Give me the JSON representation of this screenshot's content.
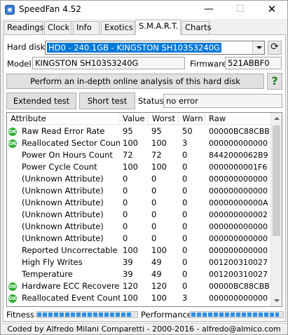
{
  "window": {
    "title": "SpeedFan 4.52",
    "minimize": "—",
    "maximize": "☐",
    "close": "✕"
  },
  "tabs": [
    {
      "label": "Readings"
    },
    {
      "label": "Clock"
    },
    {
      "label": "Info"
    },
    {
      "label": "Exotics"
    },
    {
      "label": "S.M.A.R.T."
    },
    {
      "label": "Charts"
    }
  ],
  "active_tab": "S.M.A.R.T.",
  "disk": {
    "label": "Hard disk",
    "selected": "HD0 - 240.1GB - KINGSTON SH103S3240G",
    "model_label": "Model",
    "model": "KINGSTON SH103S3240G",
    "firmware_label": "Firmware",
    "firmware": "521ABBF0"
  },
  "buttons": {
    "analysis": "Perform an in-depth online analysis of this hard disk",
    "help": "?",
    "extended": "Extended test",
    "short": "Short test"
  },
  "status": {
    "label": "Status",
    "value": "no error"
  },
  "table": {
    "headers": {
      "attribute": "Attribute",
      "value": "Value",
      "worst": "Worst",
      "warn": "Warn",
      "raw": "Raw"
    },
    "rows": [
      {
        "ok": true,
        "attribute": "Raw Read Error Rate",
        "value": "95",
        "worst": "95",
        "warn": "50",
        "raw": "00000BC88CBB"
      },
      {
        "ok": true,
        "attribute": "Reallocated Sector Count",
        "value": "100",
        "worst": "100",
        "warn": "3",
        "raw": "000000000000"
      },
      {
        "ok": false,
        "attribute": "Power On Hours Count",
        "value": "72",
        "worst": "72",
        "warn": "0",
        "raw": "8442000062B9"
      },
      {
        "ok": false,
        "attribute": "Power Cycle Count",
        "value": "100",
        "worst": "100",
        "warn": "0",
        "raw": "0000000001F6"
      },
      {
        "ok": false,
        "attribute": "(Unknown Attribute)",
        "value": "0",
        "worst": "0",
        "warn": "0",
        "raw": "000000000000"
      },
      {
        "ok": false,
        "attribute": "(Unknown Attribute)",
        "value": "0",
        "worst": "0",
        "warn": "0",
        "raw": "000000000000"
      },
      {
        "ok": false,
        "attribute": "(Unknown Attribute)",
        "value": "0",
        "worst": "0",
        "warn": "0",
        "raw": "00000000000A"
      },
      {
        "ok": false,
        "attribute": "(Unknown Attribute)",
        "value": "0",
        "worst": "0",
        "warn": "0",
        "raw": "000000000002"
      },
      {
        "ok": false,
        "attribute": "(Unknown Attribute)",
        "value": "0",
        "worst": "0",
        "warn": "0",
        "raw": "000000000000"
      },
      {
        "ok": false,
        "attribute": "(Unknown Attribute)",
        "value": "0",
        "worst": "0",
        "warn": "0",
        "raw": "000000000000"
      },
      {
        "ok": false,
        "attribute": "Reported Uncorrectable Er...",
        "value": "100",
        "worst": "100",
        "warn": "0",
        "raw": "000000000000"
      },
      {
        "ok": false,
        "attribute": "High Fly Writes",
        "value": "39",
        "worst": "49",
        "warn": "0",
        "raw": "001200310027"
      },
      {
        "ok": false,
        "attribute": "Temperature",
        "value": "39",
        "worst": "49",
        "warn": "0",
        "raw": "001200310027"
      },
      {
        "ok": true,
        "attribute": "Hardware ECC Recovered",
        "value": "120",
        "worst": "120",
        "warn": "0",
        "raw": "00000BC88CBB"
      },
      {
        "ok": true,
        "attribute": "Reallocated Event Count",
        "value": "100",
        "worst": "100",
        "warn": "3",
        "raw": "000000000000"
      }
    ]
  },
  "meters": {
    "fitness_label": "Fitness",
    "fitness_level": 0.96,
    "performance_label": "Performance",
    "performance_level": 0.96,
    "fitness_color": "#2e8fe6",
    "performance_color": "#2e8fe6"
  },
  "statusbar": "Coded by Alfredo Milani Comparetti - 2000-2016 - alfredo@almico.com",
  "colors": {
    "ok_icon": "#2eae35",
    "selection": "#0078d7"
  }
}
